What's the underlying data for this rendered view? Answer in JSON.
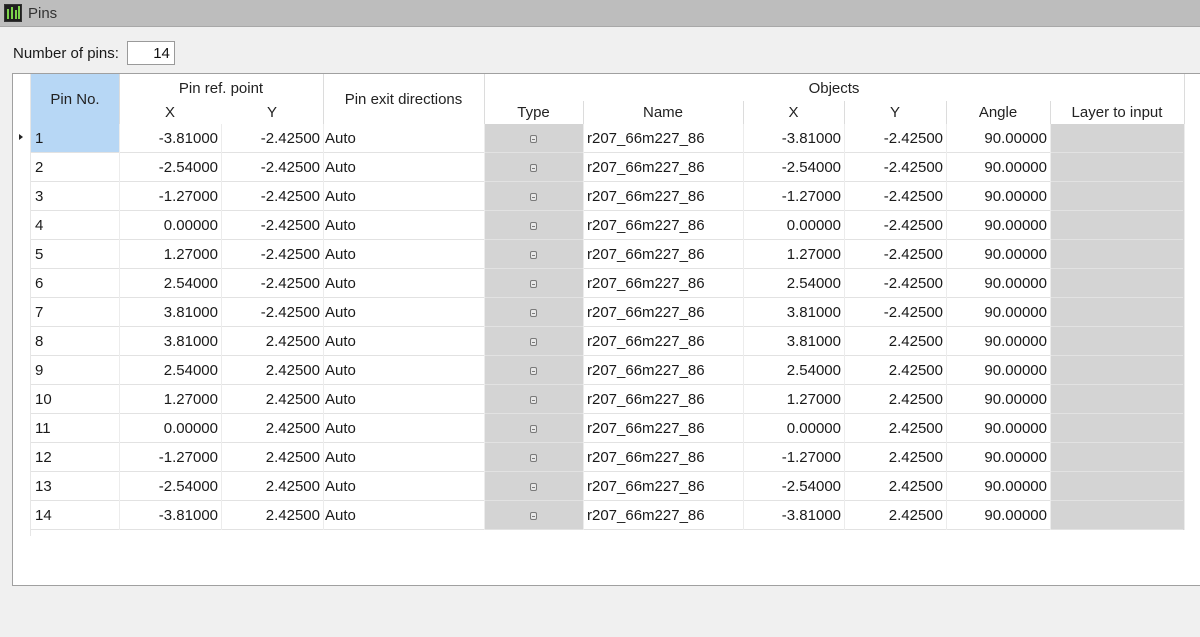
{
  "window": {
    "title": "Pins"
  },
  "pin_count": {
    "label": "Number of pins:",
    "value": "14"
  },
  "columns": {
    "pin_no": "Pin No.",
    "pin_ref_point": "Pin ref. point",
    "ref_x": "X",
    "ref_y": "Y",
    "exit_dir": "Pin exit directions",
    "objects": "Objects",
    "type": "Type",
    "name": "Name",
    "obj_x": "X",
    "obj_y": "Y",
    "angle": "Angle",
    "layer": "Layer to input"
  },
  "selected_row": 0,
  "rows": [
    {
      "pin": "1",
      "rx": "-3.81000",
      "ry": "-2.42500",
      "dir": "Auto",
      "type_icon": "object-icon",
      "name": "r207_66m227_86",
      "ox": "-3.81000",
      "oy": "-2.42500",
      "angle": "90.00000",
      "layer": ""
    },
    {
      "pin": "2",
      "rx": "-2.54000",
      "ry": "-2.42500",
      "dir": "Auto",
      "type_icon": "object-icon",
      "name": "r207_66m227_86",
      "ox": "-2.54000",
      "oy": "-2.42500",
      "angle": "90.00000",
      "layer": ""
    },
    {
      "pin": "3",
      "rx": "-1.27000",
      "ry": "-2.42500",
      "dir": "Auto",
      "type_icon": "object-icon",
      "name": "r207_66m227_86",
      "ox": "-1.27000",
      "oy": "-2.42500",
      "angle": "90.00000",
      "layer": ""
    },
    {
      "pin": "4",
      "rx": "0.00000",
      "ry": "-2.42500",
      "dir": "Auto",
      "type_icon": "object-icon",
      "name": "r207_66m227_86",
      "ox": "0.00000",
      "oy": "-2.42500",
      "angle": "90.00000",
      "layer": ""
    },
    {
      "pin": "5",
      "rx": "1.27000",
      "ry": "-2.42500",
      "dir": "Auto",
      "type_icon": "object-icon",
      "name": "r207_66m227_86",
      "ox": "1.27000",
      "oy": "-2.42500",
      "angle": "90.00000",
      "layer": ""
    },
    {
      "pin": "6",
      "rx": "2.54000",
      "ry": "-2.42500",
      "dir": "Auto",
      "type_icon": "object-icon",
      "name": "r207_66m227_86",
      "ox": "2.54000",
      "oy": "-2.42500",
      "angle": "90.00000",
      "layer": ""
    },
    {
      "pin": "7",
      "rx": "3.81000",
      "ry": "-2.42500",
      "dir": "Auto",
      "type_icon": "object-icon",
      "name": "r207_66m227_86",
      "ox": "3.81000",
      "oy": "-2.42500",
      "angle": "90.00000",
      "layer": ""
    },
    {
      "pin": "8",
      "rx": "3.81000",
      "ry": "2.42500",
      "dir": "Auto",
      "type_icon": "object-icon",
      "name": "r207_66m227_86",
      "ox": "3.81000",
      "oy": "2.42500",
      "angle": "90.00000",
      "layer": ""
    },
    {
      "pin": "9",
      "rx": "2.54000",
      "ry": "2.42500",
      "dir": "Auto",
      "type_icon": "object-icon",
      "name": "r207_66m227_86",
      "ox": "2.54000",
      "oy": "2.42500",
      "angle": "90.00000",
      "layer": ""
    },
    {
      "pin": "10",
      "rx": "1.27000",
      "ry": "2.42500",
      "dir": "Auto",
      "type_icon": "object-icon",
      "name": "r207_66m227_86",
      "ox": "1.27000",
      "oy": "2.42500",
      "angle": "90.00000",
      "layer": ""
    },
    {
      "pin": "11",
      "rx": "0.00000",
      "ry": "2.42500",
      "dir": "Auto",
      "type_icon": "object-icon",
      "name": "r207_66m227_86",
      "ox": "0.00000",
      "oy": "2.42500",
      "angle": "90.00000",
      "layer": ""
    },
    {
      "pin": "12",
      "rx": "-1.27000",
      "ry": "2.42500",
      "dir": "Auto",
      "type_icon": "object-icon",
      "name": "r207_66m227_86",
      "ox": "-1.27000",
      "oy": "2.42500",
      "angle": "90.00000",
      "layer": ""
    },
    {
      "pin": "13",
      "rx": "-2.54000",
      "ry": "2.42500",
      "dir": "Auto",
      "type_icon": "object-icon",
      "name": "r207_66m227_86",
      "ox": "-2.54000",
      "oy": "2.42500",
      "angle": "90.00000",
      "layer": ""
    },
    {
      "pin": "14",
      "rx": "-3.81000",
      "ry": "2.42500",
      "dir": "Auto",
      "type_icon": "object-icon",
      "name": "r207_66m227_86",
      "ox": "-3.81000",
      "oy": "2.42500",
      "angle": "90.00000",
      "layer": ""
    }
  ]
}
